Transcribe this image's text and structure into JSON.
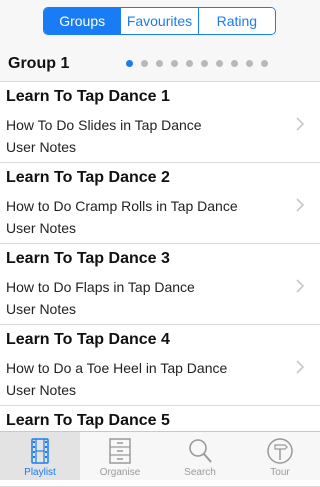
{
  "segments": [
    {
      "label": "Groups",
      "active": true
    },
    {
      "label": "Favourites",
      "active": false
    },
    {
      "label": "Rating",
      "active": false
    }
  ],
  "group": {
    "title": "Group 1",
    "pages": 10,
    "current_page": 1
  },
  "items": [
    {
      "title": "Learn To Tap Dance 1",
      "subtitle": "How To Do Slides in Tap Dance",
      "notes": "User Notes"
    },
    {
      "title": "Learn To Tap Dance 2",
      "subtitle": "How to Do Cramp Rolls in Tap Dance",
      "notes": "User Notes"
    },
    {
      "title": "Learn To Tap Dance 3",
      "subtitle": "How to Do Flaps in Tap Dance",
      "notes": "User Notes"
    },
    {
      "title": "Learn To Tap Dance 4",
      "subtitle": "How to Do a Toe Heel in Tap Dance",
      "notes": "User Notes"
    },
    {
      "title": "Learn To Tap Dance 5",
      "subtitle": "",
      "notes": ""
    }
  ],
  "tabs": [
    {
      "label": "Playlist",
      "icon": "film-icon",
      "active": true
    },
    {
      "label": "Organise",
      "icon": "cabinet-icon",
      "active": false
    },
    {
      "label": "Search",
      "icon": "magnifier-icon",
      "active": false
    },
    {
      "label": "Tour",
      "icon": "signpost-icon",
      "active": false
    }
  ],
  "colors": {
    "accent": "#1a7cf5",
    "inactive": "#9a9a9a",
    "separator": "#d9d9d9"
  }
}
